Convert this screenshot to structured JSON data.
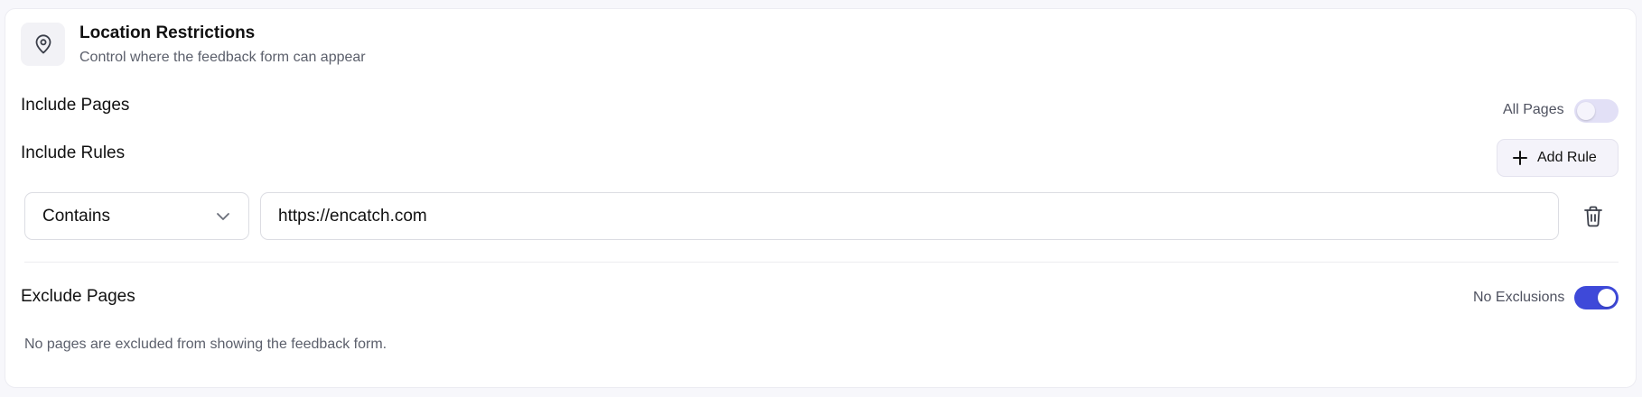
{
  "header": {
    "icon": "map-pin-icon",
    "title": "Location Restrictions",
    "subtitle": "Control where the feedback form can appear"
  },
  "include_pages": {
    "label": "Include Pages",
    "toggle_label": "All Pages",
    "toggle_on": false
  },
  "include_rules": {
    "label": "Include Rules",
    "add_rule_label": "Add Rule",
    "rules": [
      {
        "operator": "Contains",
        "value": "https://encatch.com"
      }
    ]
  },
  "exclude_pages": {
    "label": "Exclude Pages",
    "toggle_label": "No Exclusions",
    "toggle_on": true,
    "empty_message": "No pages are excluded from showing the feedback form."
  },
  "colors": {
    "accent": "#3e49d9",
    "toggle_off": "#e2e0f6",
    "muted_text": "#5b5f6b"
  }
}
